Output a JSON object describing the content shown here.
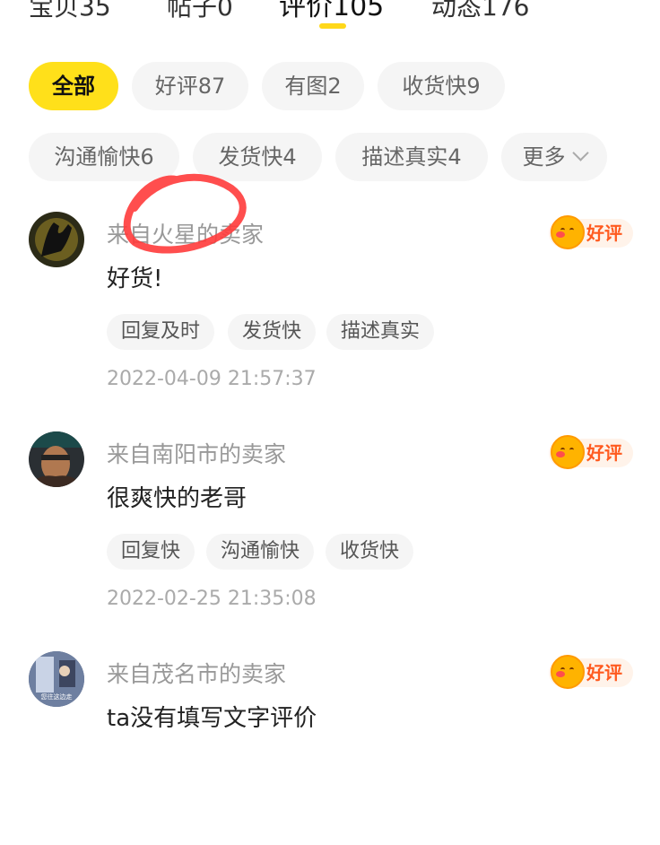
{
  "tabs": [
    {
      "label": "宝贝35",
      "active": false
    },
    {
      "label": "帖子0",
      "active": false
    },
    {
      "label": "评价105",
      "active": true
    },
    {
      "label": "动态176",
      "active": false
    }
  ],
  "filters": {
    "row1": [
      "全部",
      "好评87",
      "有图2",
      "收货快9"
    ],
    "row2": [
      "沟通愉快6",
      "发货快4",
      "描述真实4"
    ],
    "more": "更多"
  },
  "reviews": [
    {
      "seller": "来自火星的卖家",
      "badge": "好评",
      "text": "好货!",
      "tags": [
        "回复及时",
        "发货快",
        "描述真实"
      ],
      "time": "2022-04-09 21:57:37"
    },
    {
      "seller": "来自南阳市的卖家",
      "badge": "好评",
      "text": "很爽快的老哥",
      "tags": [
        "回复快",
        "沟通愉快",
        "收货快"
      ],
      "time": "2022-02-25 21:35:08"
    },
    {
      "seller": "来自茂名市的卖家",
      "badge": "好评",
      "text": "ta没有填写文字评价",
      "avatar_caption": "您往这边走"
    }
  ],
  "colors": {
    "accent": "#ffe01a",
    "badge_text": "#ff5a1f",
    "annotation": "#ff3b3b"
  }
}
